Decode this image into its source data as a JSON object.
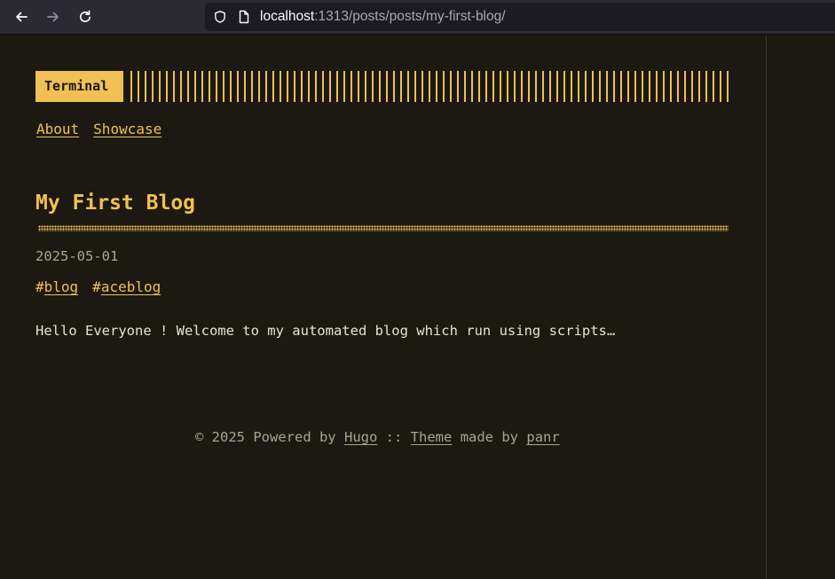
{
  "browser": {
    "url_host": "localhost",
    "url_rest": ":1313/posts/posts/my-first-blog/",
    "icons": [
      "back-arrow-icon",
      "forward-arrow-icon",
      "reload-icon",
      "shield-icon",
      "page-icon"
    ]
  },
  "header": {
    "logo": "Terminal",
    "menu": [
      {
        "label": "About"
      },
      {
        "label": "Showcase"
      }
    ]
  },
  "post": {
    "title": "My First Blog",
    "date": "2025-05-01",
    "tags": [
      {
        "hash": "#",
        "label": "blog"
      },
      {
        "hash": "#",
        "label": "aceblog"
      }
    ],
    "content": "Hello Everyone ! Welcome to my automated blog which run using scripts…"
  },
  "footer": {
    "copyright": "© 2025 Powered by",
    "hugo_link": "Hugo",
    "separator": "::",
    "theme_link": "Theme",
    "made_by": "made by",
    "author_link": "panr"
  },
  "colors": {
    "accent": "#f0c054",
    "background": "#1b1912",
    "text": "#e6e2d3",
    "muted": "#a9a48f"
  }
}
